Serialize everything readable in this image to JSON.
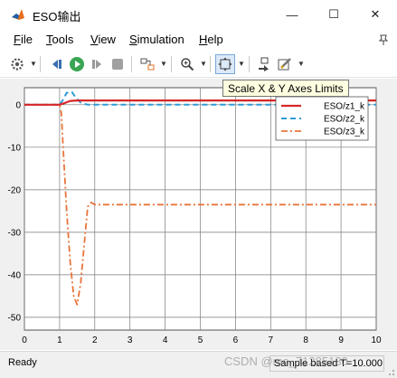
{
  "window": {
    "title": "ESO输出",
    "minimize_glyph": "—",
    "maximize_glyph": "☐",
    "close_glyph": "✕"
  },
  "menu": {
    "items": [
      {
        "first": "F",
        "rest": "ile"
      },
      {
        "first": "T",
        "rest": "ools"
      },
      {
        "first": "V",
        "rest": "iew"
      },
      {
        "first": "S",
        "rest": "imulation"
      },
      {
        "first": "H",
        "rest": "elp"
      }
    ]
  },
  "toolbar": {
    "icons": [
      "settings-icon",
      "step-back-icon",
      "run-icon",
      "step-forward-icon",
      "stop-icon",
      "signal-select-icon",
      "zoom-icon",
      "autoscale-icon",
      "highlight-simulink-block-icon",
      "style-icon"
    ]
  },
  "tooltip": {
    "text": "Scale X & Y Axes Limits"
  },
  "colors": {
    "plot_bg": "#ffffff",
    "grid": "#7a7a7a",
    "z1": "#d62728",
    "z2": "#2e9bd6",
    "z3": "#e8743b"
  },
  "chart_data": {
    "type": "line",
    "title": "",
    "xlabel": "",
    "ylabel": "",
    "xlim": [
      0,
      10
    ],
    "ylim": [
      -53,
      4
    ],
    "xticks": [
      "0",
      "1",
      "2",
      "3",
      "4",
      "5",
      "6",
      "7",
      "8",
      "9",
      "10"
    ],
    "yticks": [
      "0",
      "-10",
      "-20",
      "-30",
      "-40",
      "-50"
    ],
    "grid": true,
    "legend_position": "top-right",
    "series": [
      {
        "name": "ESO/z1_k",
        "style": "solid",
        "x": [
          0,
          1.0,
          1.15,
          1.3,
          1.5,
          2.0,
          10
        ],
        "y": [
          0,
          0,
          0.4,
          0.9,
          1.0,
          1.0,
          1.0
        ]
      },
      {
        "name": "ESO/z2_k",
        "style": "dashed",
        "x": [
          0,
          1.0,
          1.1,
          1.2,
          1.35,
          1.45,
          1.6,
          1.8,
          2.0,
          10
        ],
        "y": [
          0,
          0,
          1.2,
          2.8,
          3.0,
          1.8,
          0.5,
          0,
          0,
          0
        ]
      },
      {
        "name": "ESO/z3_k",
        "style": "dashdot",
        "x": [
          0,
          1.0,
          1.05,
          1.1,
          1.2,
          1.3,
          1.4,
          1.5,
          1.6,
          1.7,
          1.8,
          1.9,
          2.0,
          10
        ],
        "y": [
          0,
          0,
          -2,
          -10,
          -25,
          -37,
          -45,
          -47,
          -42,
          -33,
          -24,
          -23,
          -23.5,
          -23.5
        ]
      }
    ]
  },
  "status": {
    "left": "Ready",
    "right": "Sample based   T=10.000"
  },
  "watermark": "CSDN @mo_71285130"
}
